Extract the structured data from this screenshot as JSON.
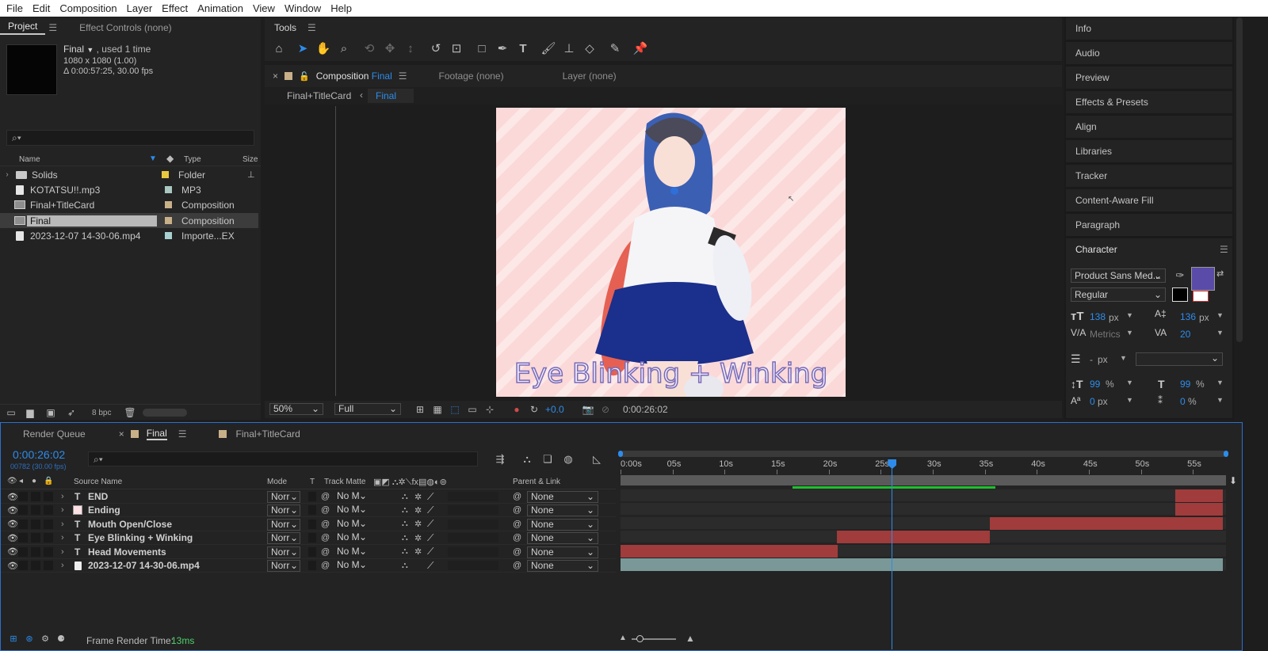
{
  "menu": [
    "File",
    "Edit",
    "Composition",
    "Layer",
    "Effect",
    "Animation",
    "View",
    "Window",
    "Help"
  ],
  "project_panel": {
    "tab_project": "Project",
    "tab_effect_controls": "Effect Controls (none)",
    "selected_name": "Final",
    "used": ", used 1 time",
    "dimensions": "1080 x 1080 (1.00)",
    "duration": "Δ 0:00:57:25, 30.00 fps",
    "search_placeholder": "",
    "columns": {
      "name": "Name",
      "type": "Type",
      "size": "Size"
    },
    "items": [
      {
        "name": "Solids",
        "type": "Folder",
        "color": "#e8c840",
        "icon": "folder-icon"
      },
      {
        "name": "KOTATSU!!.mp3",
        "type": "MP3",
        "color": "#a8c8c0",
        "icon": "audio-file-icon"
      },
      {
        "name": "Final+TitleCard",
        "type": "Composition",
        "color": "#c8b088",
        "icon": "composition-icon"
      },
      {
        "name": "Final",
        "type": "Composition",
        "color": "#c8b088",
        "icon": "composition-icon"
      },
      {
        "name": "2023-12-07 14-30-06.mp4",
        "type": "Importe...EX",
        "color": "#a8d0d0",
        "icon": "video-file-icon"
      }
    ],
    "bpc": "8 bpc"
  },
  "tools_panel": {
    "title": "Tools"
  },
  "viewer": {
    "tab_composition": "Composition",
    "tab_composition_name": "Final",
    "tab_footage": "Footage (none)",
    "tab_layer": "Layer (none)",
    "breadcrumb_parent": "Final+TitleCard",
    "breadcrumb_current": "Final",
    "overlay_text": "Eye Blinking + Winking",
    "zoom": "50%",
    "resolution": "Full",
    "exposure": "+0.0",
    "timecode": "0:00:26:02"
  },
  "right_panel": {
    "items": [
      "Info",
      "Audio",
      "Preview",
      "Effects & Presets",
      "Align",
      "Libraries",
      "Tracker",
      "Content-Aware Fill",
      "Paragraph"
    ],
    "character": {
      "title": "Character",
      "font": "Product Sans Med...",
      "style": "Regular",
      "font_size": "138",
      "leading": "136",
      "kerning": "Metrics",
      "tracking": "20",
      "stroke_width": "-",
      "vert_scale": "99",
      "horiz_scale": "99",
      "baseline": "0",
      "tsume": "0",
      "px": "px",
      "percent": "%",
      "fill_color": "#5b4ba8"
    }
  },
  "timeline": {
    "tab_render_queue": "Render Queue",
    "tab_final": "Final",
    "tab_titlecard": "Final+TitleCard",
    "current_time": "0:00:26:02",
    "frame_info": "00782 (30.00 fps)",
    "columns": {
      "source_name": "Source Name",
      "mode": "Mode",
      "t": "T",
      "track_matte": "Track Matte",
      "parent": "Parent & Link"
    },
    "ruler_labels": [
      "0:00s",
      "05s",
      "10s",
      "15s",
      "20s",
      "25s",
      "30s",
      "35s",
      "40s",
      "45s",
      "50s",
      "55s"
    ],
    "layers": [
      {
        "name": "END",
        "kind": "text",
        "mode": "Norr",
        "matte": "No M",
        "parent": "None",
        "bar_start_s": 53.3,
        "bar_end_s": 57.9,
        "bar_color": "#a03c3c"
      },
      {
        "name": "Ending",
        "kind": "solid",
        "mode": "Norr",
        "matte": "No M",
        "parent": "None",
        "bar_start_s": 53.3,
        "bar_end_s": 57.9,
        "bar_color": "#a03c3c"
      },
      {
        "name": "Mouth Open/Close",
        "kind": "text",
        "mode": "Norr",
        "matte": "No M",
        "parent": "None",
        "bar_start_s": 35.5,
        "bar_end_s": 57.9,
        "bar_color": "#a03c3c"
      },
      {
        "name": "Eye Blinking + Winking",
        "kind": "text",
        "mode": "Norr",
        "matte": "No M",
        "parent": "None",
        "bar_start_s": 20.8,
        "bar_end_s": 35.5,
        "bar_color": "#a03c3c"
      },
      {
        "name": "Head Movements",
        "kind": "text",
        "mode": "Norr",
        "matte": "No M",
        "parent": "None",
        "bar_start_s": 0.0,
        "bar_end_s": 20.9,
        "bar_color": "#a03c3c"
      },
      {
        "name": "2023-12-07 14-30-06.mp4",
        "kind": "video",
        "mode": "Norr",
        "matte": "No M",
        "parent": "None",
        "bar_start_s": 0.0,
        "bar_end_s": 57.9,
        "bar_color": "#7a9898"
      }
    ],
    "work_area_start_s": 16.5,
    "work_area_end_s": 36.0,
    "playhead_s": 26.07,
    "frame_render_label": "Frame Render Time:",
    "frame_render_value": "13ms"
  }
}
